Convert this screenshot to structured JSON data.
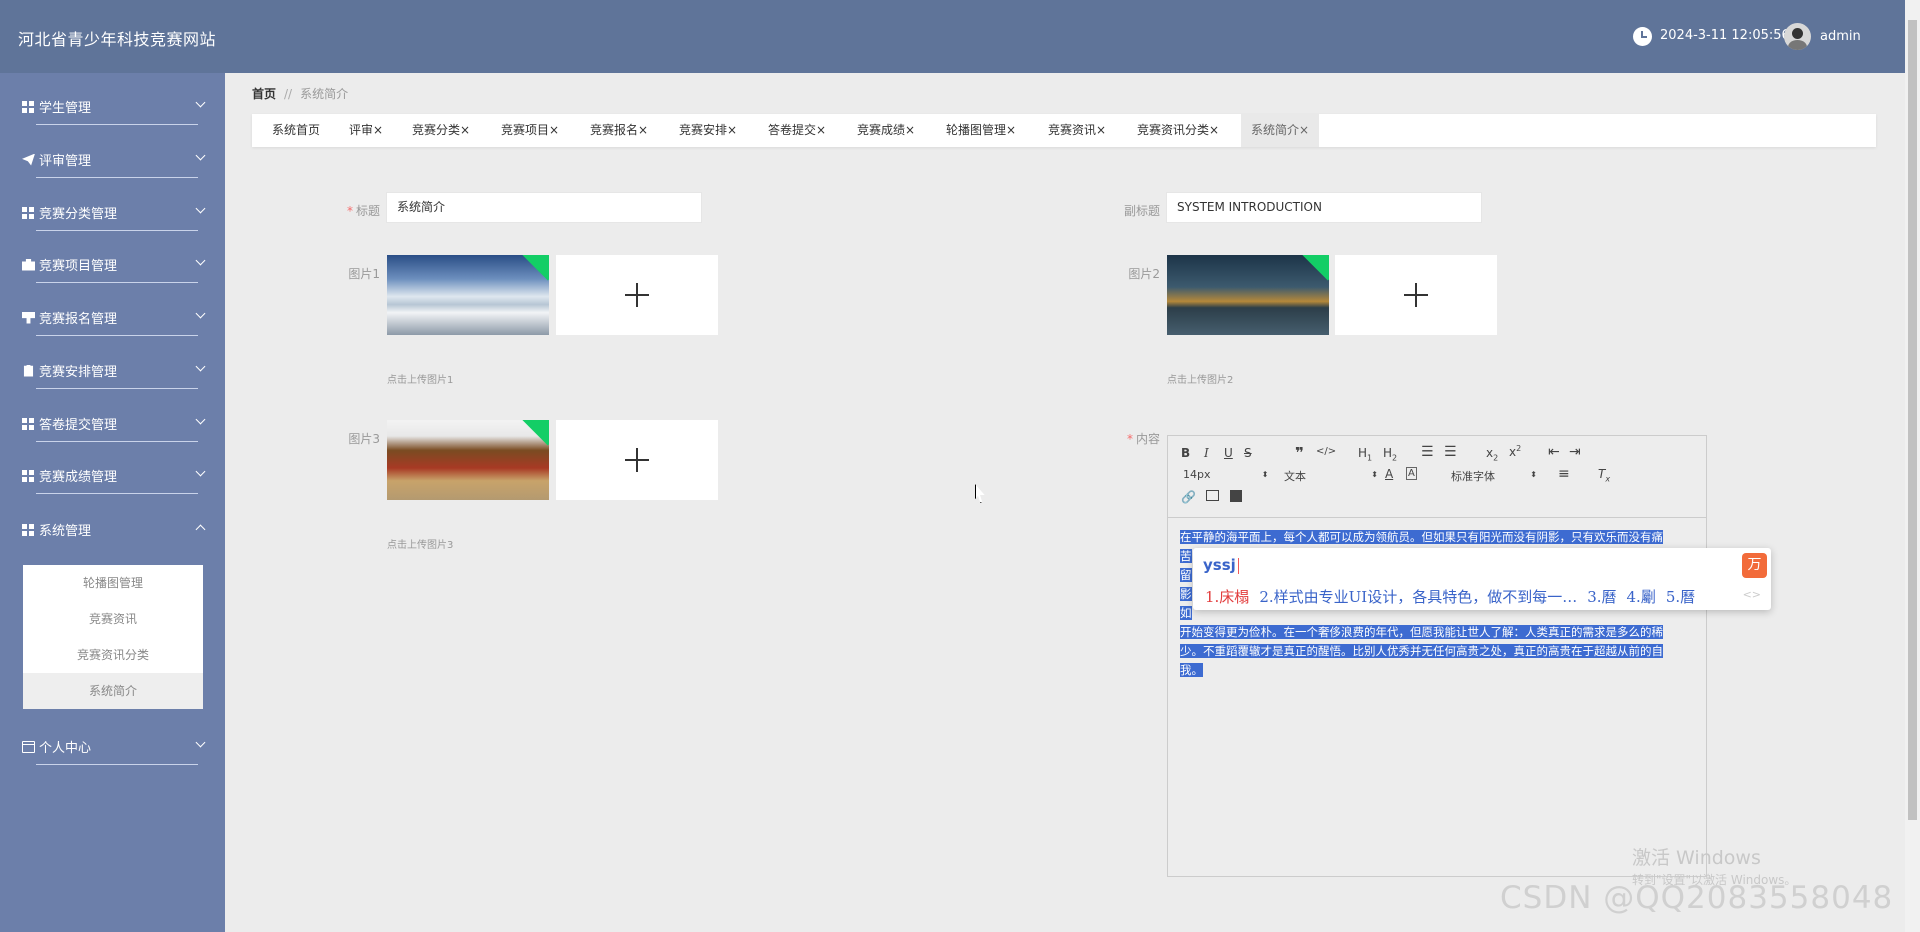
{
  "header": {
    "site_title": "河北省青少年科技竞赛网站",
    "datetime": "2024-3-11 12:05:56",
    "username": "admin"
  },
  "sidebar": {
    "items": [
      {
        "label": "学生管理",
        "icon": "grid-icon"
      },
      {
        "label": "评审管理",
        "icon": "paper-plane-icon"
      },
      {
        "label": "竞赛分类管理",
        "icon": "grid-icon"
      },
      {
        "label": "竞赛项目管理",
        "icon": "briefcase-icon"
      },
      {
        "label": "竞赛报名管理",
        "icon": "stamp-icon"
      },
      {
        "label": "竞赛安排管理",
        "icon": "clipboard-icon"
      },
      {
        "label": "答卷提交管理",
        "icon": "grid-icon"
      },
      {
        "label": "竞赛成绩管理",
        "icon": "grid-icon"
      },
      {
        "label": "系统管理",
        "icon": "grid-icon"
      },
      {
        "label": "个人中心",
        "icon": "id-card-icon"
      }
    ],
    "submenu": [
      "轮播图管理",
      "竞赛资讯",
      "竞赛资讯分类",
      "系统简介"
    ]
  },
  "breadcrumb": {
    "home": "首页",
    "separator": "//",
    "current": "系统简介"
  },
  "tabs": [
    "系统首页",
    "评审",
    "竞赛分类",
    "竞赛项目",
    "竞赛报名",
    "竞赛安排",
    "答卷提交",
    "竞赛成绩",
    "轮播图管理",
    "竞赛资讯",
    "竞赛资讯分类",
    "系统简介"
  ],
  "tab_close": "×",
  "form": {
    "title_label": "标题",
    "title_value": "系统简介",
    "subtitle_label": "副标题",
    "subtitle_value": "SYSTEM INTRODUCTION",
    "pic1_label": "图片1",
    "pic1_hint": "点击上传图片1",
    "pic2_label": "图片2",
    "pic2_hint": "点击上传图片2",
    "pic3_label": "图片3",
    "pic3_hint": "点击上传图片3",
    "content_label": "内容",
    "required_mark": "*"
  },
  "editor": {
    "font_size": "14px",
    "text_type": "文本",
    "font_family": "标准字体",
    "content_lines": [
      "在平静的海平面上，每个人都可以成为领航员。但如果只有阳光而没有阴影，只有欢乐而没有痛",
      "苦",
      "留",
      "影",
      "如",
      "开始变得更为俭朴。在一个奢侈浪费的年代，但愿我能让世人了解：人类真正的需求是多么的稀",
      "少。不重蹈覆辙才是真正的醒悟。比别人优秀并无任何高贵之处，真正的高贵在于超越从前的自",
      "我。"
    ]
  },
  "ime": {
    "input": "yssj",
    "logo": "万",
    "candidates": [
      "1.床榻",
      "2.样式由专业UI设计，各具特色，做不到每一…",
      "3.曆",
      "4.劚",
      "5.曆"
    ],
    "arrows": "<>"
  },
  "watermarks": {
    "windows_line1": "激活 Windows",
    "windows_line2": "转到\"设置\"以激活 Windows。",
    "csdn": "CSDN @QQ2083558048"
  }
}
